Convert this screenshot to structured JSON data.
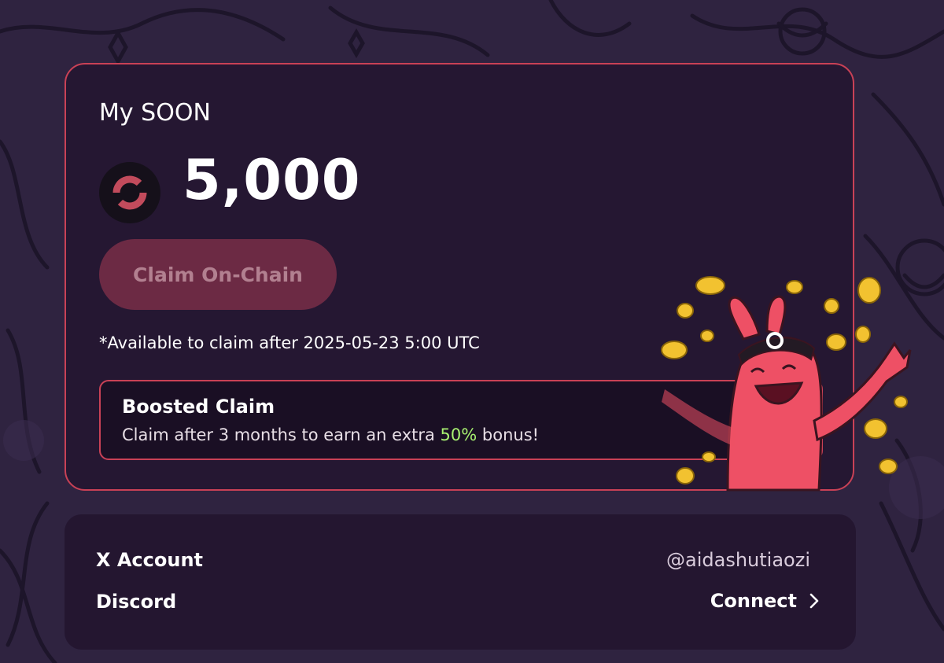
{
  "card": {
    "title": "My SOON",
    "token_icon": "soon-token-icon",
    "balance": "5,000",
    "claim_button_label": "Claim On-Chain",
    "claim_note": "*Available to claim after 2025-05-23 5:00 UTC"
  },
  "boost": {
    "title": "Boosted Claim",
    "desc_prefix": "Claim after 3 months to earn an extra ",
    "desc_highlight": "50%",
    "desc_suffix": " bonus!",
    "icon": "chevron-right-icon"
  },
  "accounts": {
    "x_label": "X Account",
    "x_handle": "@aidashutiaozi",
    "discord_label": "Discord",
    "discord_action": "Connect",
    "discord_icon": "chevron-right-icon"
  },
  "colors": {
    "accent": "#c94156",
    "highlight": "#a8f171",
    "background": "#2f2340"
  }
}
